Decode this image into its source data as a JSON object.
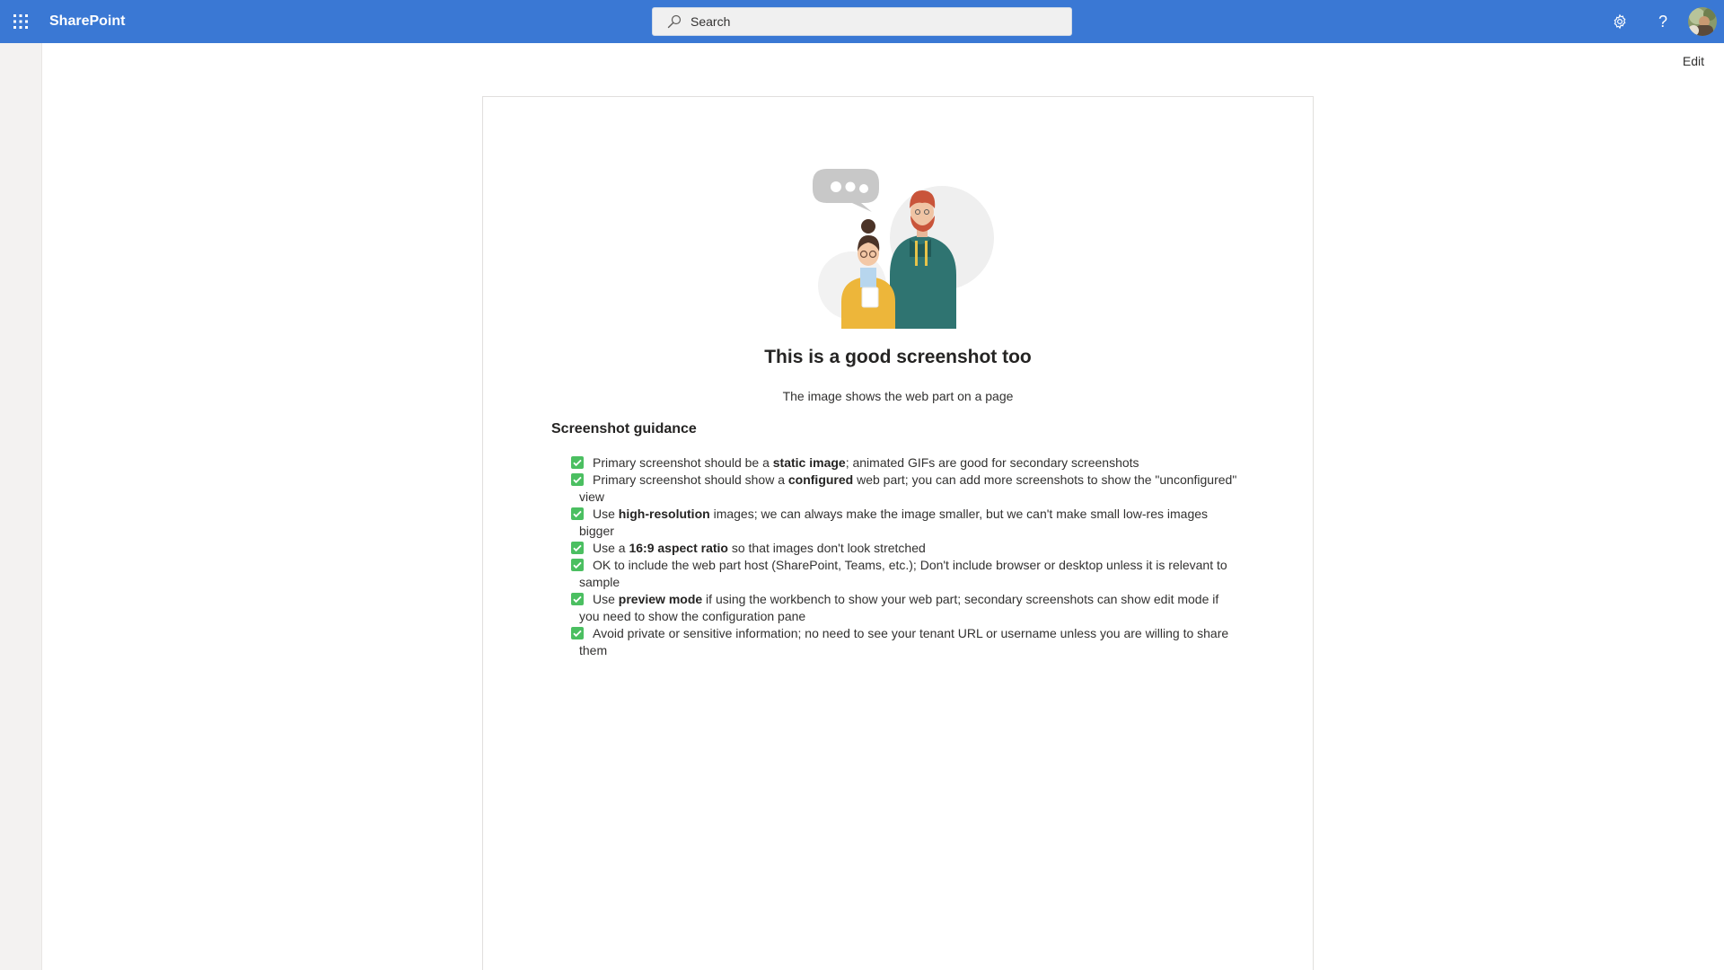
{
  "suitebar": {
    "app_name": "SharePoint",
    "search_placeholder": "Search",
    "accent_color": "#3a78d4"
  },
  "page": {
    "edit_label": "Edit"
  },
  "card": {
    "title": "This is a good screenshot too",
    "subtitle": "The image shows the web part on a page",
    "guidance_heading": "Screenshot guidance",
    "guidance": [
      {
        "a": "Primary screenshot should be a ",
        "b": "static image",
        "c": "; animated GIFs are good for secondary screenshots"
      },
      {
        "a": "Primary screenshot should show a ",
        "b": "configured",
        "c": " web part; you can add more screenshots to show the \"unconfigured\" view"
      },
      {
        "a": "Use ",
        "b": "high-resolution",
        "c": " images; we can always make the image smaller, but we can't make small low-res images bigger"
      },
      {
        "a": "Use a ",
        "b": "16:9 aspect ratio",
        "c": " so that images don't look stretched"
      },
      {
        "a": "OK to include the web part host (SharePoint, Teams, etc.); Don't include browser or desktop unless it is relevant to sample",
        "b": "",
        "c": ""
      },
      {
        "a": "Use ",
        "b": "preview mode",
        "c": " if using the workbench to show your web part; secondary screenshots can show edit mode if you need to show the configuration pane"
      },
      {
        "a": "Avoid private or sensitive information; no need to see your tenant URL or username unless you are willing to share them",
        "b": "",
        "c": ""
      }
    ],
    "check_color": "#4bbf61"
  },
  "icons": {
    "waffle": "app-launcher-icon",
    "search": "search-icon",
    "settings": "gear-icon",
    "help": "help-icon",
    "check": "checkbox-checked-icon"
  }
}
